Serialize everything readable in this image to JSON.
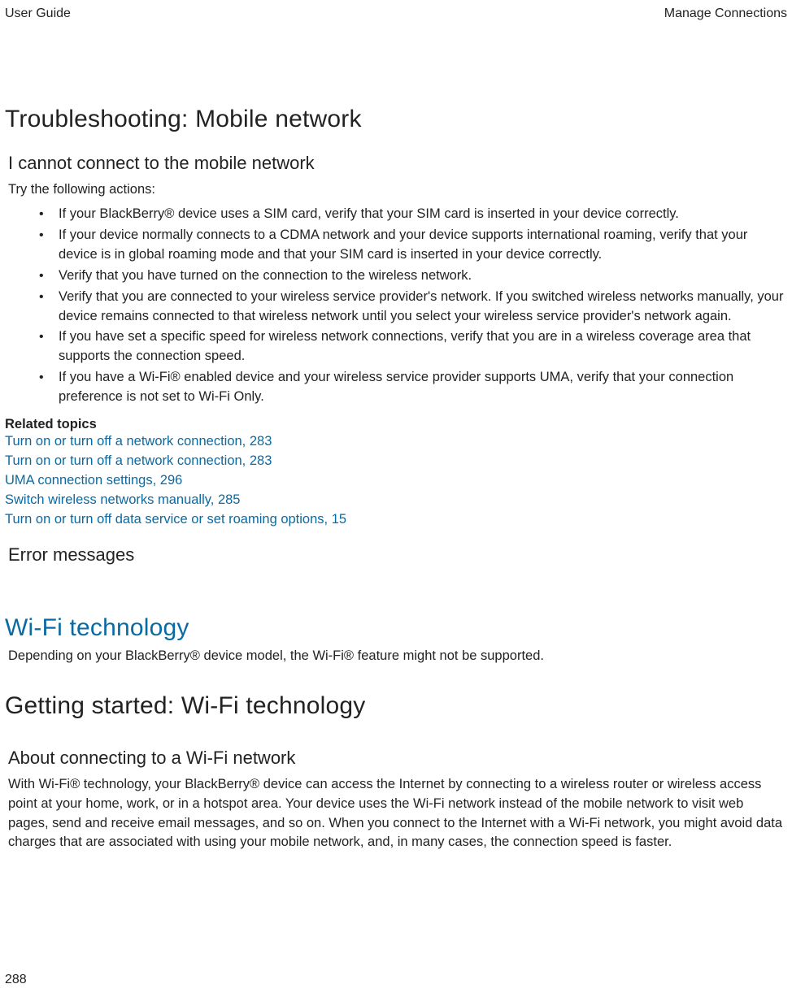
{
  "header": {
    "left": "User Guide",
    "right": "Manage Connections"
  },
  "section1": {
    "title": "Troubleshooting: Mobile network",
    "sub1": {
      "title": "I cannot connect to the mobile network",
      "intro": "Try the following actions:",
      "bullets": [
        "If your BlackBerry® device uses a SIM card, verify that your SIM card is inserted in your device correctly.",
        "If your device normally connects to a CDMA network and your device supports international roaming, verify that your device is in global roaming mode and that your SIM card is inserted in your device correctly.",
        "Verify that you have turned on the connection to the wireless network.",
        "Verify that you are connected to your wireless service provider's network. If you switched wireless networks manually, your device remains connected to that wireless network until you select your wireless service provider's network again.",
        "If you have set a specific speed for wireless network connections, verify that you are in a wireless coverage area that supports the connection speed.",
        "If you have a Wi-Fi® enabled device and your wireless service provider supports UMA, verify that your connection preference is not set to Wi-Fi Only."
      ],
      "related_head": "Related topics",
      "related_links": [
        "Turn on or turn off a network connection, 283",
        "Turn on or turn off a network connection, 283",
        "UMA connection settings, 296",
        "Switch wireless networks manually, 285",
        "Turn on or turn off data service or set roaming options, 15"
      ]
    },
    "sub2": {
      "title": "Error messages"
    }
  },
  "section2": {
    "title": "Wi-Fi technology",
    "intro": "Depending on your BlackBerry® device model, the Wi-Fi® feature might not be supported."
  },
  "section3": {
    "title": "Getting started: Wi-Fi technology",
    "sub1": {
      "title": "About connecting to a Wi-Fi network",
      "body": "With Wi-Fi® technology, your BlackBerry® device can access the Internet by connecting to a wireless router or wireless access point at your home, work, or in a hotspot area. Your device uses the Wi-Fi network instead of the mobile network to visit web pages, send and receive email messages, and so on. When you connect to the Internet with a Wi-Fi network, you might avoid data charges that are associated with using your mobile network, and, in many cases, the connection speed is faster."
    }
  },
  "page_number": "288"
}
